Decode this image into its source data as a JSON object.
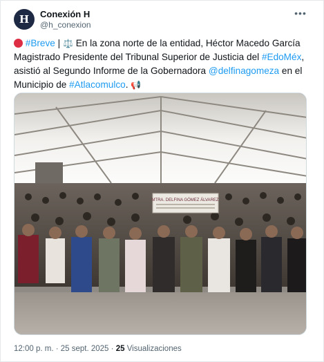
{
  "author": {
    "display_name": "Conexión H",
    "handle": "@h_conexion",
    "avatar_letter": "H"
  },
  "menu_icon": "more-dots-icon",
  "tweet": {
    "breve_tag": "#Breve",
    "separator": "|",
    "text_1": "En la zona norte de la entidad, Héctor Macedo García Magistrado Presidente del Tribunal Superior de Justicia del",
    "edomex_tag": "#EdoMéx",
    "text_2": ", asistió al Segundo Informe de la Gobernadora",
    "mention": "@delfinagomeza",
    "text_3": "en el Municipio de",
    "atlacomulco_tag": "#Atlacomulco",
    "text_4": "."
  },
  "media": {
    "banner_text": "MTRA. DELFINA GÓMEZ ÁLVAREZ"
  },
  "meta": {
    "time_date": "12:00 p. m. · 25 sept. 2025 ·",
    "views_count": "25",
    "views_label": "Visualizaciones"
  },
  "colors": {
    "link": "#1d9bf0",
    "text": "#0f1419",
    "muted": "#536471"
  }
}
